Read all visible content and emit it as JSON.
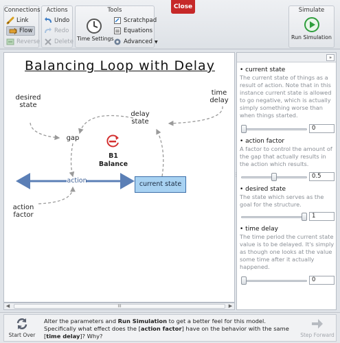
{
  "toolbar": {
    "connections": {
      "title": "Connections",
      "link": "Link",
      "flow": "Flow",
      "reverse": "Reverse"
    },
    "actions": {
      "title": "Actions",
      "undo": "Undo",
      "redo": "Redo",
      "delete": "Delete"
    },
    "tools": {
      "title": "Tools",
      "time_settings": "Time Settings",
      "scratchpad": "Scratchpad",
      "equations": "Equations",
      "advanced": "Advanced"
    },
    "close": "Close",
    "simulate": {
      "title": "Simulate",
      "run": "Run Simulation"
    }
  },
  "diagram": {
    "title": "Balancing Loop with Delay",
    "desired_state": "desired state",
    "time_delay": "time delay",
    "delay_state": "delay state",
    "gap": "gap",
    "loop_id": "B1",
    "loop_name": "Balance",
    "action": "action",
    "current_state": "current state",
    "action_factor": "action factor"
  },
  "scroll": {
    "grip": "III"
  },
  "panel": {
    "collapse": "»",
    "params": [
      {
        "name": "current state",
        "description": "The current state of things as a result of action. Note that in this instance current state is allowed to go negative, which is actually simply something worse than when things started.",
        "value": "0",
        "level": 0.0
      },
      {
        "name": "action factor",
        "description": "A factor to control the amount of the gap that actually results in the action which results.",
        "value": "0.5",
        "level": 0.5
      },
      {
        "name": "desired state",
        "description": "The state which serves as the goal for the structure.",
        "value": "1",
        "level": 1.0
      },
      {
        "name": "time delay",
        "description": "The time period the current state value is to be delayed. It's simply as though one looks at the value some time after it actually happened.",
        "value": "0",
        "level": 0.0
      }
    ]
  },
  "bottom": {
    "start_over": "Start Over",
    "step_forward": "Step Forward",
    "instr_1": "Alter the parameters and ",
    "instr_2": "Run Simulation",
    "instr_3": " to get a better feel for this model. Specifically what effect does the [",
    "instr_4": "action factor",
    "instr_5": "] have on the behavior with the same [",
    "instr_6": "time delay",
    "instr_7": "]? Why?"
  },
  "colors": {
    "close": "#c62828",
    "stock_fill": "#a8d2f2",
    "flow_arrow": "#3c6ea8",
    "loop_icon": "#d32f2f",
    "run_icon": "#2e9e3c"
  }
}
